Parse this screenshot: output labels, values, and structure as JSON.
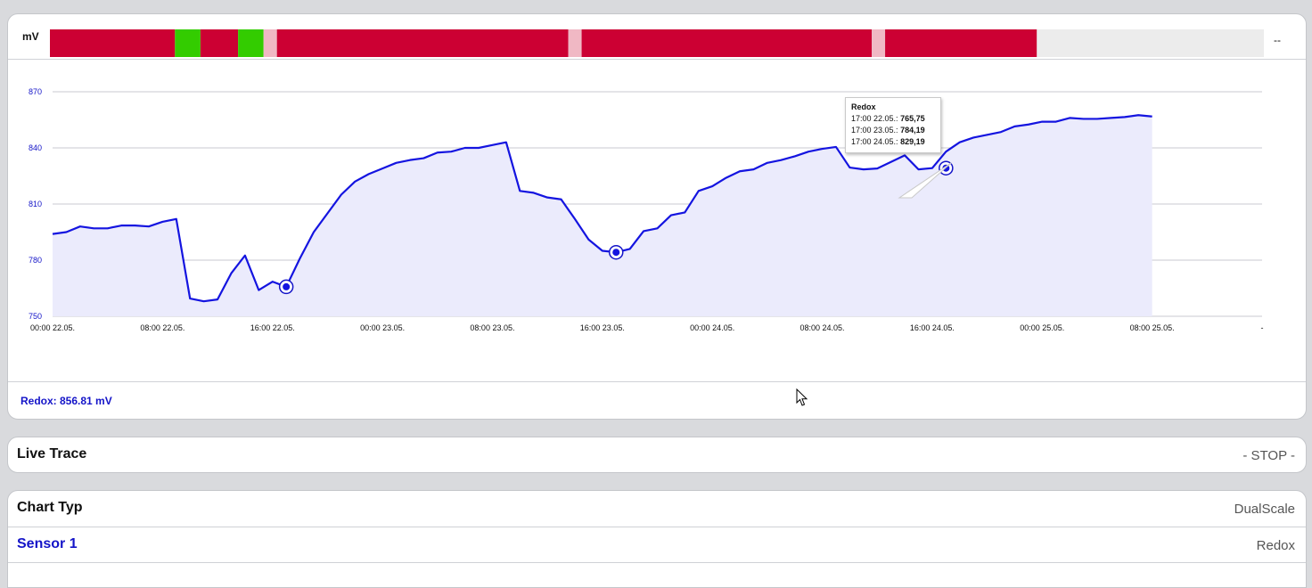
{
  "chart_panel": {
    "unit": "mV",
    "band_end_label": "--",
    "legend": "Redox: 856.81 mV",
    "status_band": {
      "colors": {
        "red": "#cc0033",
        "green": "#33cc00",
        "pink": "#f0b8c4",
        "empty": "#ececec"
      },
      "segments": [
        {
          "state": "red",
          "from": 0,
          "to": 0.103
        },
        {
          "state": "green",
          "from": 0.103,
          "to": 0.124
        },
        {
          "state": "red",
          "from": 0.124,
          "to": 0.155
        },
        {
          "state": "green",
          "from": 0.155,
          "to": 0.176
        },
        {
          "state": "pink",
          "from": 0.176,
          "to": 0.187
        },
        {
          "state": "red",
          "from": 0.187,
          "to": 0.427
        },
        {
          "state": "pink",
          "from": 0.427,
          "to": 0.438
        },
        {
          "state": "red",
          "from": 0.438,
          "to": 0.677
        },
        {
          "state": "pink",
          "from": 0.677,
          "to": 0.688
        },
        {
          "state": "red",
          "from": 0.688,
          "to": 0.813
        },
        {
          "state": "empty",
          "from": 0.813,
          "to": 1.0
        }
      ]
    },
    "tooltip": {
      "title": "Redox",
      "lines": [
        {
          "label": "17:00 22.05.:",
          "value": "765,75"
        },
        {
          "label": "17:00 23.05.:",
          "value": "784,19"
        },
        {
          "label": "17:00 24.05.:",
          "value": "829,19"
        }
      ]
    }
  },
  "chart_data": {
    "type": "area",
    "series": [
      {
        "name": "Redox",
        "color": "#1414e0",
        "fill": "#ebebfc"
      }
    ],
    "ylim": [
      750,
      870
    ],
    "yticks": [
      750,
      780,
      810,
      840,
      870
    ],
    "xlim": [
      0,
      80
    ],
    "xticks": [
      {
        "hour": 0,
        "label": "00:00 22.05."
      },
      {
        "hour": 8,
        "label": "08:00 22.05."
      },
      {
        "hour": 16,
        "label": "16:00 22.05."
      },
      {
        "hour": 24,
        "label": "00:00 23.05."
      },
      {
        "hour": 32,
        "label": "08:00 23.05."
      },
      {
        "hour": 40,
        "label": "16:00 23.05."
      },
      {
        "hour": 48,
        "label": "00:00 24.05."
      },
      {
        "hour": 56,
        "label": "08:00 24.05."
      },
      {
        "hour": 64,
        "label": "16:00 24.05."
      },
      {
        "hour": 72,
        "label": "00:00 25.05."
      },
      {
        "hour": 80,
        "label": "08:00 25.05."
      },
      {
        "hour": 88,
        "label": "-"
      }
    ],
    "hour_axis_note": "hour 0 = 00:00 22.05.",
    "points": [
      [
        0,
        794
      ],
      [
        1,
        795
      ],
      [
        2,
        798
      ],
      [
        3,
        797
      ],
      [
        4,
        797
      ],
      [
        5,
        798.5
      ],
      [
        6,
        798.5
      ],
      [
        7,
        798
      ],
      [
        8,
        800.5
      ],
      [
        9,
        802
      ],
      [
        10,
        759.5
      ],
      [
        11,
        758
      ],
      [
        12,
        759
      ],
      [
        13,
        773
      ],
      [
        14,
        782.5
      ],
      [
        15,
        764
      ],
      [
        16,
        768.5
      ],
      [
        17,
        765.75
      ],
      [
        18,
        781
      ],
      [
        19,
        795
      ],
      [
        20,
        805
      ],
      [
        21,
        815
      ],
      [
        22,
        822
      ],
      [
        23,
        826
      ],
      [
        24,
        829
      ],
      [
        25,
        832
      ],
      [
        26,
        833.5
      ],
      [
        27,
        834.5
      ],
      [
        28,
        837.5
      ],
      [
        29,
        838
      ],
      [
        30,
        840
      ],
      [
        31,
        840
      ],
      [
        32,
        841.5
      ],
      [
        33,
        843
      ],
      [
        34,
        817
      ],
      [
        35,
        816
      ],
      [
        36,
        813.5
      ],
      [
        37,
        812.5
      ],
      [
        38,
        802
      ],
      [
        39,
        791
      ],
      [
        40,
        785
      ],
      [
        41,
        784.19
      ],
      [
        42,
        786
      ],
      [
        43,
        795.5
      ],
      [
        44,
        797
      ],
      [
        45,
        804
      ],
      [
        46,
        805.5
      ],
      [
        47,
        817
      ],
      [
        48,
        819.5
      ],
      [
        49,
        824
      ],
      [
        50,
        827.5
      ],
      [
        51,
        828.5
      ],
      [
        52,
        832
      ],
      [
        53,
        833.5
      ],
      [
        54,
        835.5
      ],
      [
        55,
        838
      ],
      [
        56,
        839.5
      ],
      [
        57,
        840.5
      ],
      [
        58,
        829.5
      ],
      [
        59,
        828.5
      ],
      [
        60,
        829
      ],
      [
        61,
        832.5
      ],
      [
        62,
        836
      ],
      [
        63,
        828.5
      ],
      [
        64,
        829.19
      ],
      [
        65,
        838
      ],
      [
        66,
        843
      ],
      [
        67,
        845.5
      ],
      [
        68,
        847
      ],
      [
        69,
        848.5
      ],
      [
        70,
        851.5
      ],
      [
        71,
        852.5
      ],
      [
        72,
        854
      ],
      [
        73,
        854
      ],
      [
        74,
        856
      ],
      [
        75,
        855.5
      ],
      [
        76,
        855.5
      ],
      [
        77,
        856
      ],
      [
        78,
        856.5
      ],
      [
        79,
        857.5
      ],
      [
        80,
        856.8
      ]
    ],
    "markers": [
      17,
      41,
      65
    ],
    "marker_values": [
      765.75,
      784.19,
      829.19
    ]
  },
  "live_trace": {
    "title": "Live Trace",
    "value": "- STOP -"
  },
  "settings": {
    "chart_type_label": "Chart Typ",
    "chart_type_value": "DualScale",
    "sensor_label": "Sensor 1",
    "sensor_value": "Redox"
  }
}
